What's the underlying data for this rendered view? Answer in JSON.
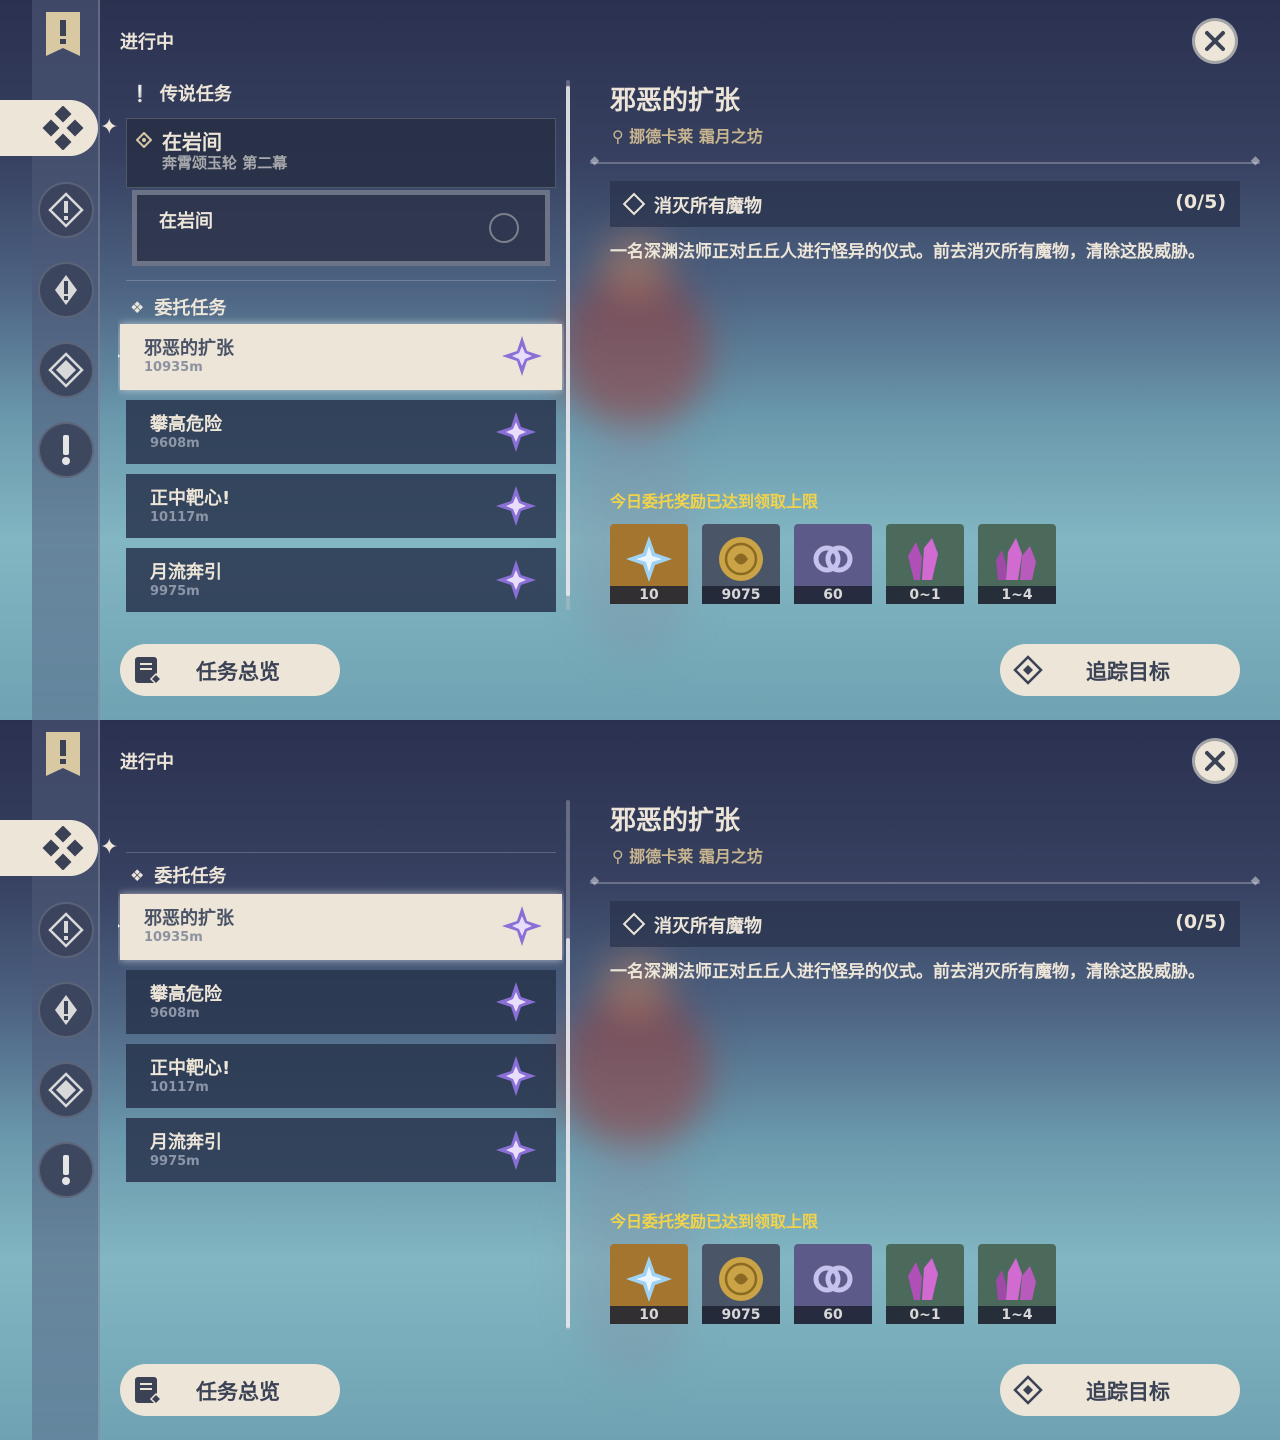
{
  "status_label": "进行中",
  "legend": {
    "section": "传说任务",
    "quest_title": "在岩间",
    "quest_sub": "奔霄颂玉轮 第二幕",
    "sub_card": "在岩间"
  },
  "commissions": {
    "section": "委托任务",
    "items": [
      {
        "name": "邪恶的扩张",
        "dist": "10935m"
      },
      {
        "name": "攀高危险",
        "dist": "9608m"
      },
      {
        "name": "正中靶心!",
        "dist": "10117m"
      },
      {
        "name": "月流奔引",
        "dist": "9975m"
      }
    ]
  },
  "detail": {
    "title": "邪恶的扩张",
    "location": "挪德卡莱 霜月之坊",
    "objective": "消灭所有魔物",
    "objective_count": "(0/5)",
    "description": "一名深渊法师正对丘丘人进行怪异的仪式。前去消灭所有魔物，清除这股威胁。",
    "reward_note": "今日委托奖励已达到领取上限",
    "rewards": [
      {
        "icon": "primogem-icon",
        "count": "10",
        "bg": "#a3752e"
      },
      {
        "icon": "mora-icon",
        "count": "9075",
        "bg": "#4a5568"
      },
      {
        "icon": "companionship-exp-icon",
        "count": "60",
        "bg": "#5b5a88"
      },
      {
        "icon": "crystal-chunk-icon",
        "count": "0~1",
        "bg": "#4c6a5c"
      },
      {
        "icon": "crystal-chunk-icon",
        "count": "1~4",
        "bg": "#4c6a5c"
      }
    ]
  },
  "buttons": {
    "overview": "任务总览",
    "track": "追踪目标"
  },
  "colors": {
    "accent": "#ece5d8",
    "reward_note": "#f3d34a",
    "location": "#c7b58f"
  }
}
